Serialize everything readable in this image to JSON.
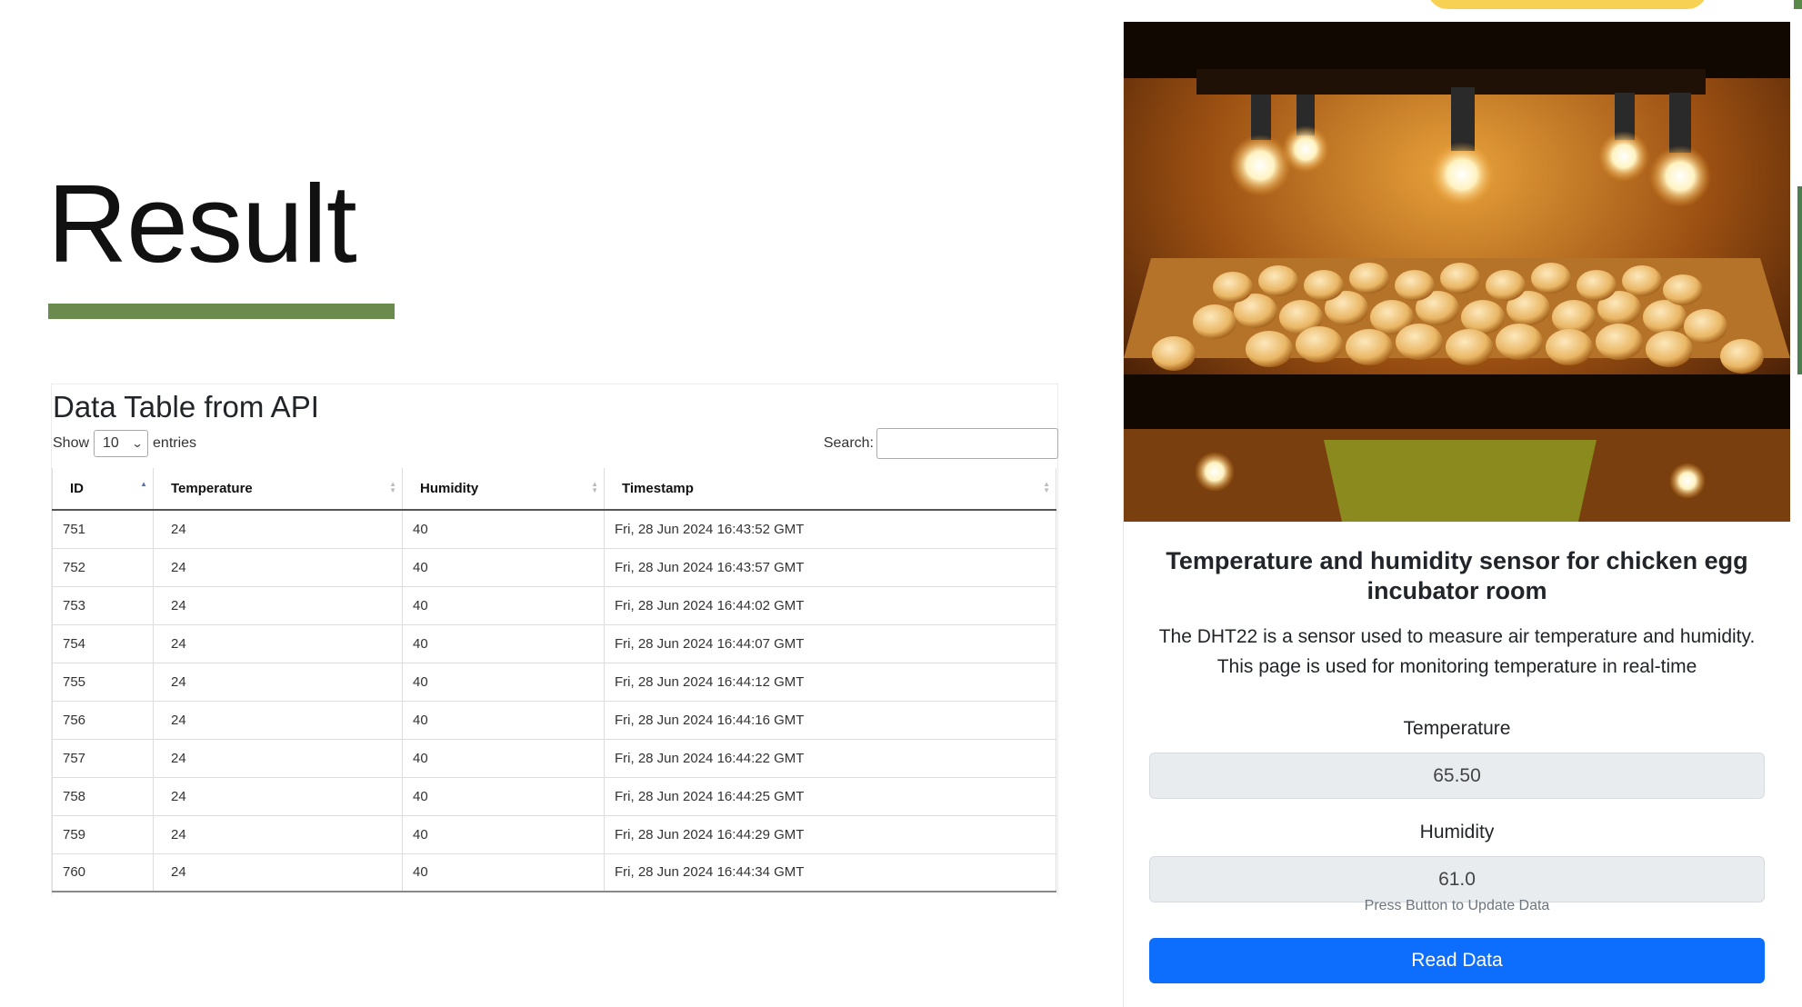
{
  "slide": {
    "title": "Result",
    "accent_bar_color": "#6b8a4e",
    "deco_yellow": "#f7d154"
  },
  "data_table": {
    "title": "Data Table from API",
    "show_label": "Show",
    "page_length": "10",
    "entries_label": "entries",
    "search_label": "Search:",
    "search_value": "",
    "columns": [
      "ID",
      "Temperature",
      "Humidity",
      "Timestamp"
    ],
    "sorted_column": "ID",
    "sort_direction": "ascending",
    "rows": [
      [
        "751",
        "24",
        "40",
        "Fri, 28 Jun 2024 16:43:52 GMT"
      ],
      [
        "752",
        "24",
        "40",
        "Fri, 28 Jun 2024 16:43:57 GMT"
      ],
      [
        "753",
        "24",
        "40",
        "Fri, 28 Jun 2024 16:44:02 GMT"
      ],
      [
        "754",
        "24",
        "40",
        "Fri, 28 Jun 2024 16:44:07 GMT"
      ],
      [
        "755",
        "24",
        "40",
        "Fri, 28 Jun 2024 16:44:12 GMT"
      ],
      [
        "756",
        "24",
        "40",
        "Fri, 28 Jun 2024 16:44:16 GMT"
      ],
      [
        "757",
        "24",
        "40",
        "Fri, 28 Jun 2024 16:44:22 GMT"
      ],
      [
        "758",
        "24",
        "40",
        "Fri, 28 Jun 2024 16:44:25 GMT"
      ],
      [
        "759",
        "24",
        "40",
        "Fri, 28 Jun 2024 16:44:29 GMT"
      ],
      [
        "760",
        "24",
        "40",
        "Fri, 28 Jun 2024 16:44:34 GMT"
      ]
    ]
  },
  "card": {
    "image": "incubator-photo",
    "title": "Temperature and humidity sensor for chicken egg incubator room",
    "description": "The DHT22 is a sensor used to measure air temperature and humidity. This page is used for monitoring temperature in real-time",
    "temperature_label": "Temperature",
    "temperature_value": "65.50",
    "humidity_label": "Humidity",
    "humidity_value": "61.0",
    "hint": "Press Button to Update Data",
    "button_label": "Read Data",
    "button_color": "#0d6efd"
  }
}
